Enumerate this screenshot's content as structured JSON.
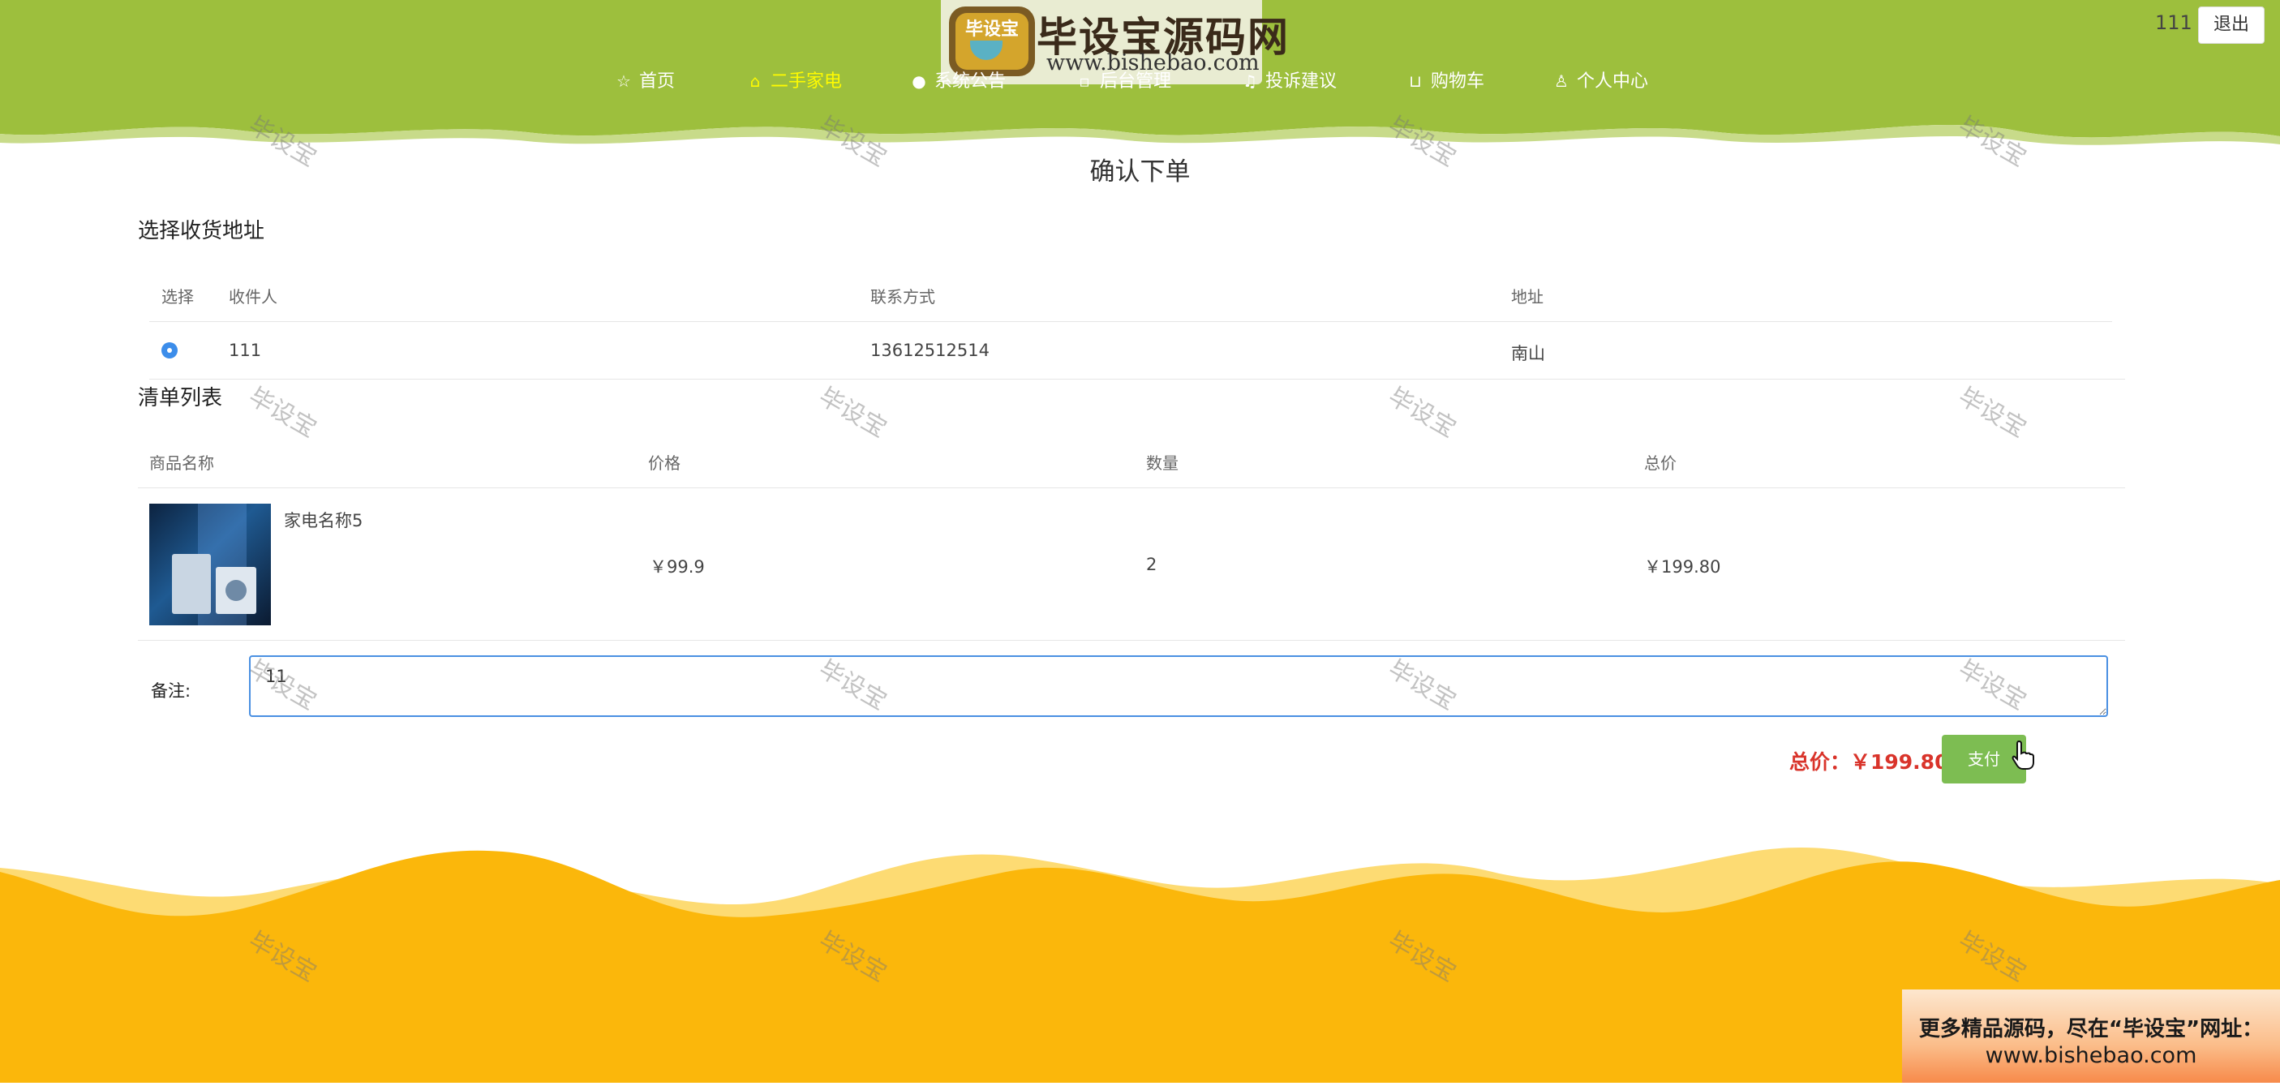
{
  "header": {
    "logo_badge": "毕设宝",
    "logo_title": "毕设宝源码网",
    "logo_url": "www.bishebao.com",
    "nav": [
      {
        "label": "首页",
        "icon": "star-icon",
        "active": false
      },
      {
        "label": "二手家电",
        "icon": "shopping-bag-icon",
        "active": true
      },
      {
        "label": "系统公告",
        "icon": "info-icon",
        "active": false
      },
      {
        "label": "后台管理",
        "icon": "dashboard-icon",
        "active": false
      },
      {
        "label": "投诉建议",
        "icon": "headset-icon",
        "active": false
      },
      {
        "label": "购物车",
        "icon": "cart-icon",
        "active": false
      },
      {
        "label": "个人中心",
        "icon": "user-icon",
        "active": false
      }
    ],
    "user_name": "111",
    "logout_label": "退出"
  },
  "page_title": "确认下单",
  "address_section": {
    "title": "选择收货地址",
    "columns": [
      "选择",
      "收件人",
      "联系方式",
      "地址"
    ],
    "rows": [
      {
        "selected": true,
        "recipient": "111",
        "phone": "13612512514",
        "address": "南山"
      }
    ]
  },
  "order_section": {
    "title": "清单列表",
    "columns": [
      "商品名称",
      "价格",
      "数量",
      "总价"
    ],
    "items": [
      {
        "name": "家电名称5",
        "price": "￥99.9",
        "quantity": "2",
        "subtotal": "￥199.80"
      }
    ]
  },
  "remark": {
    "label": "备注:",
    "value": "11"
  },
  "total": {
    "label": "总价：￥199.80"
  },
  "pay_label": "支付",
  "watermark": "毕设宝",
  "promo": {
    "line1": "更多精品源码，尽在“毕设宝”网址：",
    "line2": "www.bishebao.com"
  },
  "colors": {
    "header_green": "#9dbf3d",
    "nav_active": "#fffb00",
    "footer_yellow": "#fbb70b",
    "footer_light": "#fddb73",
    "total_red": "#d9342b",
    "pay_green": "#7dbd52",
    "radio_blue": "#3c8dea"
  }
}
